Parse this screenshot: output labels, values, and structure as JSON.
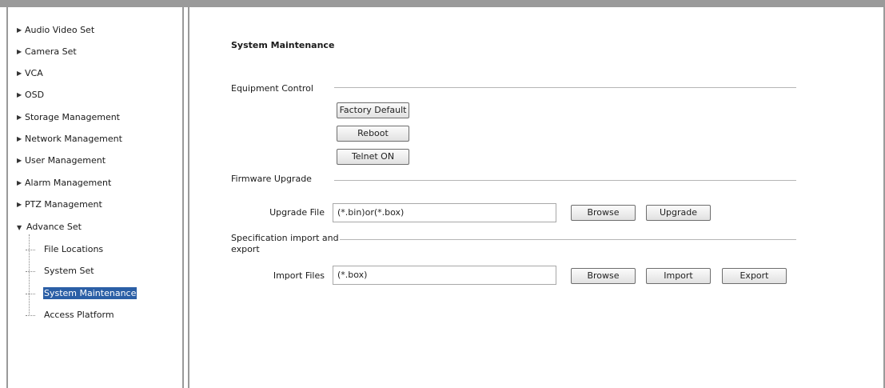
{
  "sidebar": {
    "items": [
      {
        "label": "Audio Video Set"
      },
      {
        "label": "Camera Set"
      },
      {
        "label": "VCA"
      },
      {
        "label": "OSD"
      },
      {
        "label": "Storage Management"
      },
      {
        "label": "Network Management"
      },
      {
        "label": "User Management"
      },
      {
        "label": "Alarm Management"
      },
      {
        "label": "PTZ Management"
      },
      {
        "label": "Advance Set"
      }
    ],
    "advance_children": [
      {
        "label": "File Locations"
      },
      {
        "label": "System Set"
      },
      {
        "label": "System Maintenance",
        "selected": true
      },
      {
        "label": "Access Platform"
      }
    ]
  },
  "main": {
    "title": "System Maintenance",
    "equipment_control": {
      "label": "Equipment Control",
      "factory_default": "Factory Default",
      "reboot": "Reboot",
      "telnet": "Telnet ON"
    },
    "firmware_upgrade": {
      "label": "Firmware Upgrade",
      "file_label": "Upgrade File",
      "file_value": "(*.bin)or(*.box)",
      "browse": "Browse",
      "upgrade": "Upgrade"
    },
    "spec_import_export": {
      "label_line1": "Specification import and",
      "label_line2": "export",
      "file_label": "Import Files",
      "file_value": "(*.box)",
      "browse": "Browse",
      "import": "Import",
      "export": "Export"
    }
  },
  "colors": {
    "selected_bg": "#2b5fa6",
    "border": "#9a9a9a"
  }
}
